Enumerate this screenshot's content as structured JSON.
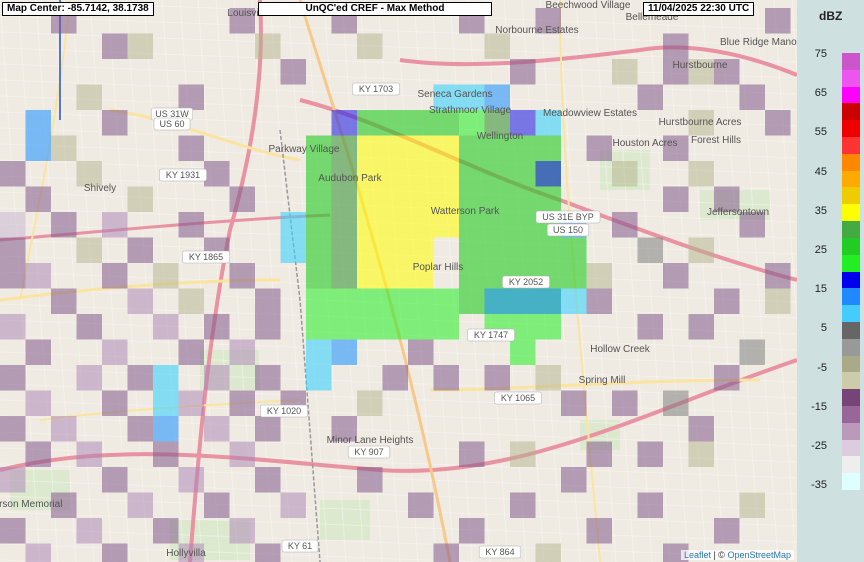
{
  "header": {
    "map_center": "Map Center: -85.7142, 38.1738",
    "title": "UnQC'ed CREF - Max Method",
    "timestamp": "11/04/2025   22:30 UTC"
  },
  "legend": {
    "unit": "dBZ",
    "labels": [
      "75",
      "65",
      "55",
      "45",
      "35",
      "25",
      "15",
      "5",
      "-5",
      "-15",
      "-25",
      "-35"
    ],
    "colors": [
      "#cc55cc",
      "#ee55ee",
      "#ff00ff",
      "#cc0000",
      "#ee0000",
      "#ff3333",
      "#ff8800",
      "#ffaa00",
      "#eecc00",
      "#ffff00",
      "#44aa44",
      "#22cc22",
      "#22ee22",
      "#0000ee",
      "#2288ff",
      "#44ccff",
      "#666666",
      "#999999",
      "#aaaa88",
      "#ccccaa",
      "#774477",
      "#996699",
      "#bb99bb",
      "#ddccdd",
      "#eeeeee",
      "#ddffff"
    ]
  },
  "attribution": {
    "leaflet": "Leaflet",
    "sep": " | © ",
    "osm": "OpenStreetMap"
  },
  "map_labels": [
    {
      "t": "Louisville",
      "kind": "place"
    },
    {
      "t": "Beechwood Village",
      "kind": "place"
    },
    {
      "t": "Bellemeade",
      "kind": "place"
    },
    {
      "t": "Norbourne Estates",
      "kind": "place"
    },
    {
      "t": "Blue Ridge Manor",
      "kind": "place"
    },
    {
      "t": "Hurstbourne",
      "kind": "place"
    },
    {
      "t": "KY 1703",
      "kind": "shield"
    },
    {
      "t": "Seneca Gardens",
      "kind": "place"
    },
    {
      "t": "Strathmoor Village",
      "kind": "place"
    },
    {
      "t": "Meadowview Estates",
      "kind": "place"
    },
    {
      "t": "US 31W",
      "kind": "shield"
    },
    {
      "t": "US 60",
      "kind": "shield"
    },
    {
      "t": "Wellington",
      "kind": "place"
    },
    {
      "t": "Houston Acres",
      "kind": "place"
    },
    {
      "t": "Hurstbourne Acres",
      "kind": "place"
    },
    {
      "t": "Forest Hills",
      "kind": "place"
    },
    {
      "t": "Parkway Village",
      "kind": "place"
    },
    {
      "t": "Shively",
      "kind": "place"
    },
    {
      "t": "KY 1931",
      "kind": "shield"
    },
    {
      "t": "Audubon Park",
      "kind": "place"
    },
    {
      "t": "Watterson Park",
      "kind": "place"
    },
    {
      "t": "US 31E BYP",
      "kind": "shield"
    },
    {
      "t": "US 150",
      "kind": "shield"
    },
    {
      "t": "Jeffersontown",
      "kind": "place"
    },
    {
      "t": "Poplar Hills",
      "kind": "place"
    },
    {
      "t": "KY 1865",
      "kind": "shield"
    },
    {
      "t": "KY 2052",
      "kind": "shield"
    },
    {
      "t": "KY 1747",
      "kind": "shield"
    },
    {
      "t": "Hollow Creek",
      "kind": "place"
    },
    {
      "t": "Spring Mill",
      "kind": "place"
    },
    {
      "t": "KY 1020",
      "kind": "shield"
    },
    {
      "t": "KY 1065",
      "kind": "shield"
    },
    {
      "t": "Minor Lane Heights",
      "kind": "place"
    },
    {
      "t": "KY 907",
      "kind": "shield"
    },
    {
      "t": "Jefferson Memorial",
      "kind": "place"
    },
    {
      "t": "Hollyvilla",
      "kind": "place"
    },
    {
      "t": "KY 61",
      "kind": "shield"
    },
    {
      "t": "KY 864",
      "kind": "shield"
    }
  ],
  "radar_cells": [
    [
      "dbz 35",
      2
    ],
    [
      "dbz 35",
      2
    ],
    [
      "dbz 35",
      2
    ],
    [
      "dbz 35",
      2
    ],
    [
      "dbz 35",
      2
    ],
    [
      "dbz 35",
      2
    ],
    [
      "dbz 25",
      6
    ],
    [
      "dbz 25",
      6
    ],
    [
      "dbz 15",
      4
    ],
    [
      "dbz 5",
      3
    ]
  ]
}
